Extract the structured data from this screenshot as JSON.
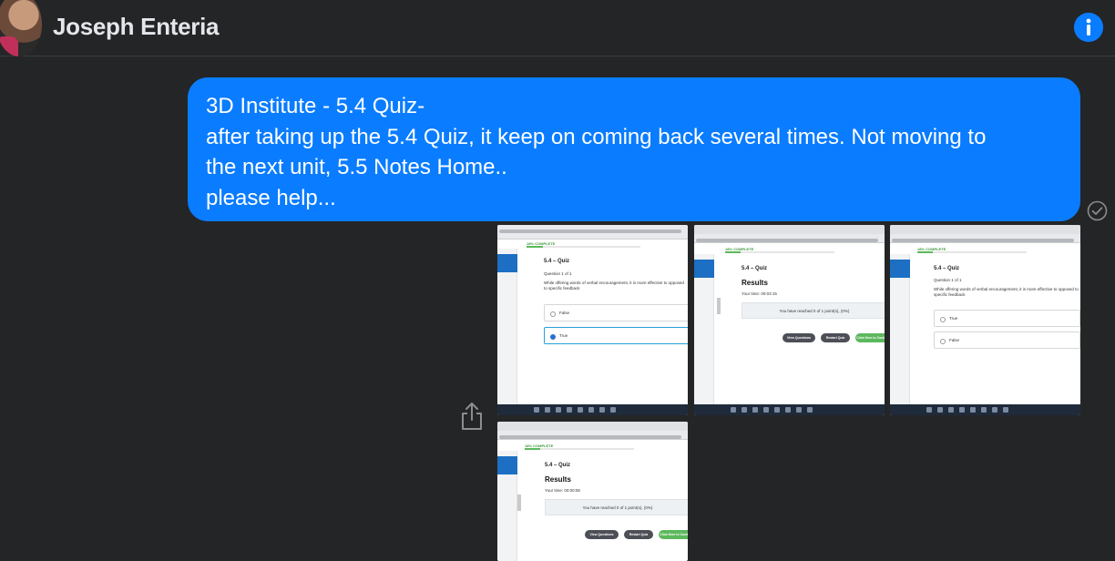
{
  "header": {
    "contact_name": "Joseph Enteria",
    "info_icon": "info-icon"
  },
  "message": {
    "lines": [
      "3D Institute - 5.4 Quiz-",
      "after taking up the 5.4 Quiz, it keep on coming back several times.  Not moving to",
      "the next unit, 5.5 Notes Home..",
      "please help..."
    ],
    "status_icon": "seen-check-icon",
    "bubble_color": "#0a7cff"
  },
  "attachments": {
    "share_icon": "share-icon",
    "quiz_screen": {
      "progress": "18% COMPLETE",
      "title": "5.4 – Quiz",
      "question_counter": "Question 1 of 1",
      "question_text": "While offering words of verbal encouragement, it is more effective to opposed to specific feedback",
      "option_false": "False",
      "option_true": "True"
    },
    "results_screen": {
      "progress": "18% COMPLETE",
      "title": "5.4 – Quiz",
      "heading": "Results",
      "time_1": "Your time: 00:03:15",
      "time_2": "Your time: 00:00:06",
      "score_text": "You have reached 0 of 1 point(s), (0%)",
      "view_questions": "View Questions",
      "restart_quiz": "Restart Quiz",
      "click_here": "Click Here to Continue"
    }
  }
}
